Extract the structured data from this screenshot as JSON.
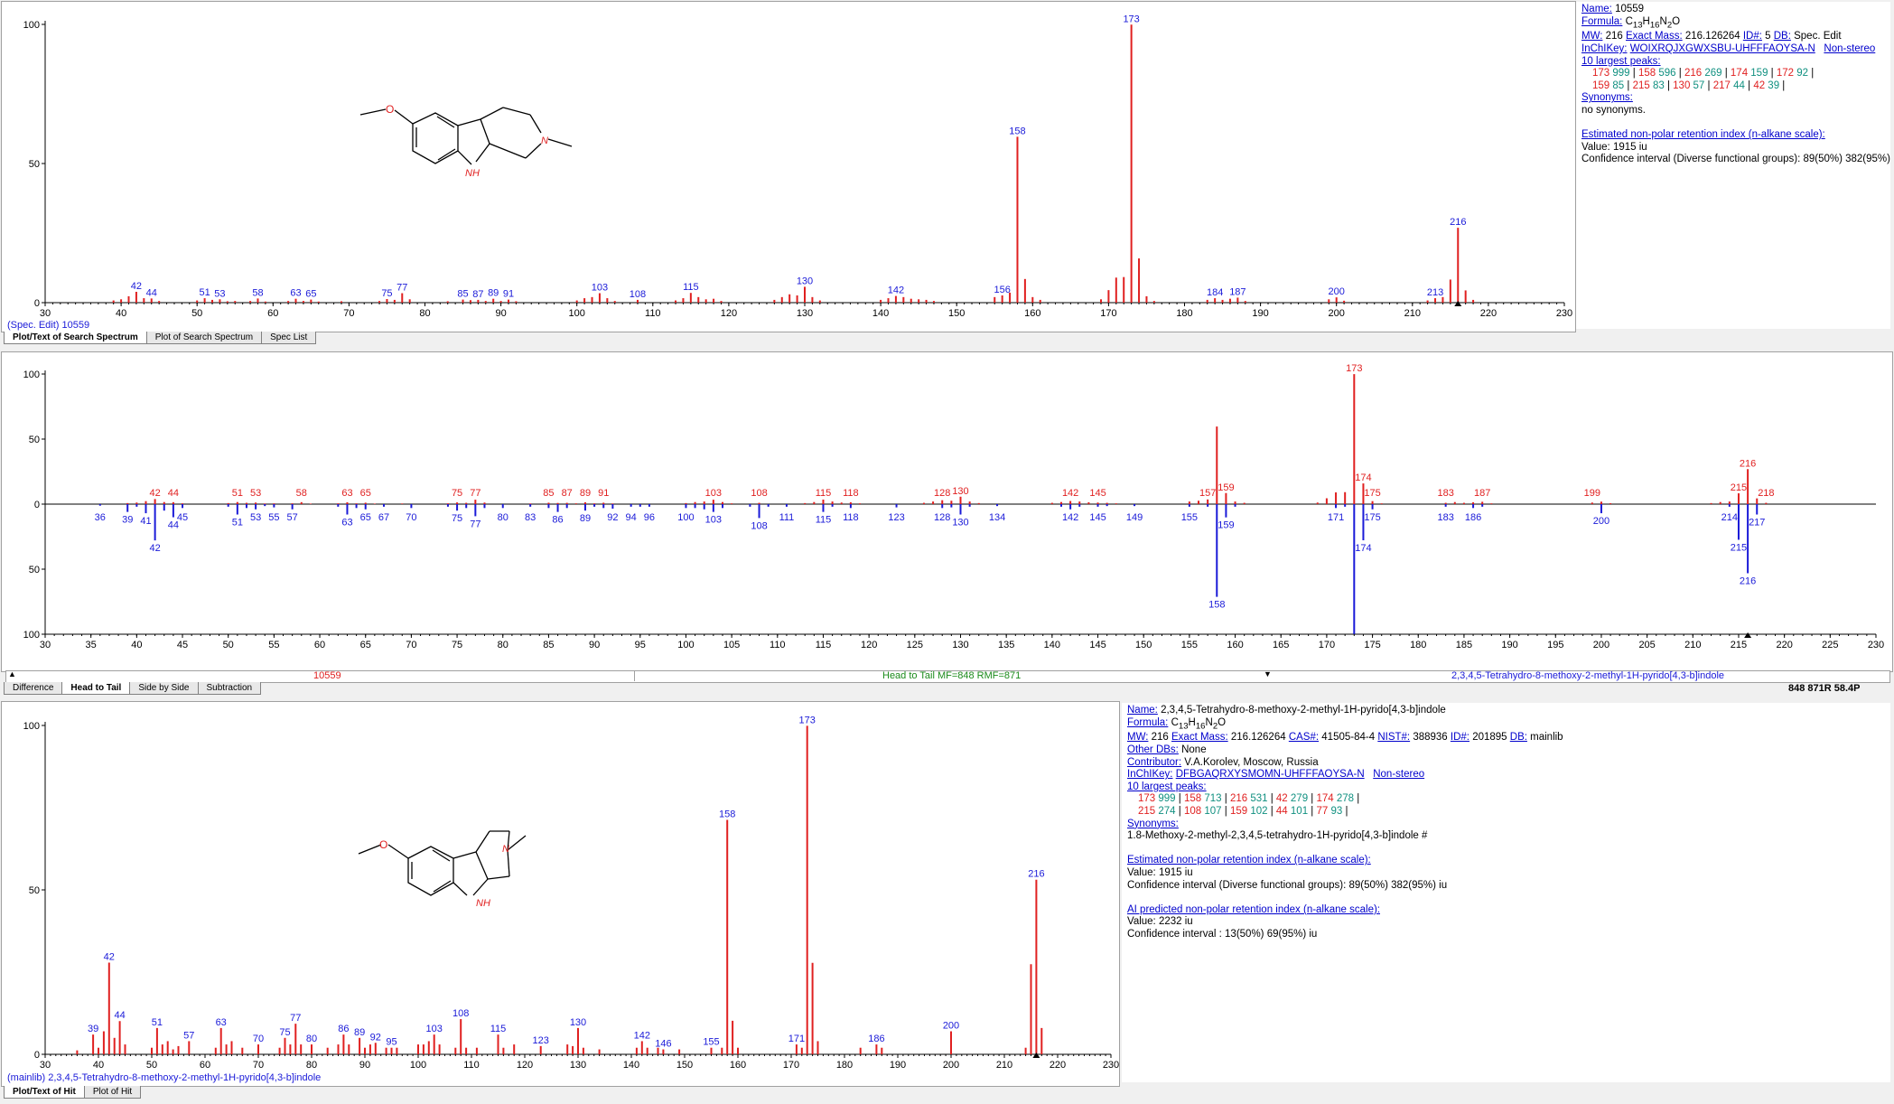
{
  "colors": {
    "match": "#e02020",
    "lib": "#1a1ad8",
    "unmatched": "#8080a0",
    "teal": "#109080",
    "status_green": "#1a8a1a"
  },
  "search": {
    "status": "(Spec. Edit) 10559",
    "tabs": [
      "Plot/Text of Search Spectrum",
      "Plot of Search Spectrum",
      "Spec List"
    ],
    "info": {
      "name_label": "Name:",
      "name": "10559",
      "formula_label": "Formula:",
      "formula": "C13H16N2O",
      "mw_label": "MW:",
      "mw": "216",
      "exact_label": "Exact Mass:",
      "exact": "216.126264",
      "id_label": "ID#:",
      "id": "5",
      "db_label": "DB:",
      "db": "Spec. Edit",
      "inchi_label": "InChIKey:",
      "inchi": "WOIXRQJXGWXSBU-UHFFFAOYSA-N",
      "nonstereo": "Non-stereo",
      "peaks_label": "10 largest peaks:",
      "peaks1": [
        [
          "173",
          "999"
        ],
        [
          "158",
          "596"
        ],
        [
          "216",
          "269"
        ],
        [
          "174",
          "159"
        ],
        [
          "172",
          "92"
        ]
      ],
      "peaks2": [
        [
          "159",
          "85"
        ],
        [
          "215",
          "83"
        ],
        [
          "130",
          "57"
        ],
        [
          "217",
          "44"
        ],
        [
          "42",
          "39"
        ]
      ],
      "syn_label": "Synonyms:",
      "syn": "no synonyms.",
      "ri_label": "Estimated non-polar retention index (n-alkane scale):",
      "ri_value": "Value: 1915 iu",
      "ri_ci": "Confidence interval (Diverse functional groups):  89(50%) 382(95%) iu"
    }
  },
  "compare": {
    "tabs": [
      "Difference",
      "Head to Tail",
      "Side by Side",
      "Subtraction"
    ],
    "left_label": "10559",
    "center_label": "Head to Tail MF=848 RMF=871",
    "right_label": "2,3,4,5-Tetrahydro-8-methoxy-2-methyl-1H-pyrido[4,3-b]indole",
    "score": "848 871R 58.4P"
  },
  "hit": {
    "status": "(mainlib) 2,3,4,5-Tetrahydro-8-methoxy-2-methyl-1H-pyrido[4,3-b]indole",
    "tabs": [
      "Plot/Text of Hit",
      "Plot of Hit"
    ],
    "info": {
      "name_label": "Name:",
      "name": "2,3,4,5-Tetrahydro-8-methoxy-2-methyl-1H-pyrido[4,3-b]indole",
      "formula_label": "Formula:",
      "formula": "C13H16N2O",
      "mw_label": "MW:",
      "mw": "216",
      "exact_label": "Exact Mass:",
      "exact": "216.126264",
      "cas_label": "CAS#:",
      "cas": "41505-84-4",
      "nist_label": "NIST#:",
      "nist": "388936",
      "id_label": "ID#:",
      "id": "201895",
      "db_label": "DB:",
      "db": "mainlib",
      "otherdb_label": "Other DBs:",
      "otherdb": "None",
      "contrib_label": "Contributor:",
      "contrib": "V.A.Korolev, Moscow, Russia",
      "inchi_label": "InChIKey:",
      "inchi": "DFBGAQRXYSMOMN-UHFFFAOYSA-N",
      "nonstereo": "Non-stereo",
      "peaks_label": "10 largest peaks:",
      "peaks1": [
        [
          "173",
          "999"
        ],
        [
          "158",
          "713"
        ],
        [
          "216",
          "531"
        ],
        [
          "42",
          "279"
        ],
        [
          "174",
          "278"
        ]
      ],
      "peaks2": [
        [
          "215",
          "274"
        ],
        [
          "108",
          "107"
        ],
        [
          "159",
          "102"
        ],
        [
          "44",
          "101"
        ],
        [
          "77",
          "93"
        ]
      ],
      "syn_label": "Synonyms:",
      "syn": "1.8-Methoxy-2-methyl-2,3,4,5-tetrahydro-1H-pyrido[4,3-b]indole  #",
      "ri_label": "Estimated non-polar retention index (n-alkane scale):",
      "ri_value": "Value: 1915 iu",
      "ri_ci": "Confidence interval (Diverse functional groups):  89(50%) 382(95%) iu",
      "ai_label": "AI predicted non-polar retention index (n-alkane scale):",
      "ai_value": "Value: 2232 iu",
      "ai_ci": "Confidence interval :  13(50%) 69(95%) iu"
    }
  },
  "structure_atoms": {
    "oxygen": "O",
    "nh": "NH",
    "n": "N"
  },
  "chart_data": [
    {
      "type": "bar",
      "name": "search-spectrum",
      "xlim": [
        30,
        230
      ],
      "ylim": [
        0,
        100
      ],
      "x_ticks": [
        30,
        40,
        50,
        60,
        70,
        80,
        90,
        100,
        110,
        120,
        130,
        140,
        150,
        160,
        170,
        180,
        190,
        200,
        210,
        220,
        230
      ],
      "y_ticks": [
        0,
        50,
        100
      ],
      "peaks": [
        [
          39,
          0.8
        ],
        [
          40,
          1.2
        ],
        [
          41,
          2.3
        ],
        [
          42,
          3.9
        ],
        [
          43,
          1.6
        ],
        [
          44,
          1.5
        ],
        [
          45,
          0.6
        ],
        [
          50,
          0.8
        ],
        [
          51,
          1.6
        ],
        [
          52,
          1.0
        ],
        [
          53,
          1.2
        ],
        [
          54,
          0.5
        ],
        [
          55,
          0.6
        ],
        [
          57,
          0.6
        ],
        [
          58,
          1.5
        ],
        [
          59,
          0.4
        ],
        [
          62,
          0.6
        ],
        [
          63,
          1.4
        ],
        [
          64,
          0.6
        ],
        [
          65,
          1.1
        ],
        [
          66,
          0.4
        ],
        [
          69,
          0.5
        ],
        [
          74,
          0.6
        ],
        [
          75,
          1.3
        ],
        [
          76,
          1.0
        ],
        [
          77,
          3.4
        ],
        [
          78,
          1.2
        ],
        [
          83,
          0.5
        ],
        [
          85,
          1.1
        ],
        [
          86,
          0.9
        ],
        [
          87,
          1.0
        ],
        [
          88,
          0.6
        ],
        [
          89,
          1.4
        ],
        [
          90,
          0.6
        ],
        [
          91,
          1.1
        ],
        [
          92,
          0.5
        ],
        [
          100,
          0.8
        ],
        [
          101,
          1.6
        ],
        [
          102,
          2.0
        ],
        [
          103,
          3.4
        ],
        [
          104,
          1.6
        ],
        [
          105,
          0.6
        ],
        [
          108,
          1.0
        ],
        [
          113,
          0.8
        ],
        [
          114,
          1.6
        ],
        [
          115,
          3.5
        ],
        [
          116,
          2.0
        ],
        [
          117,
          1.2
        ],
        [
          118,
          1.4
        ],
        [
          119,
          0.6
        ],
        [
          126,
          1.0
        ],
        [
          127,
          2.0
        ],
        [
          128,
          3.0
        ],
        [
          129,
          2.6
        ],
        [
          130,
          5.7
        ],
        [
          131,
          2.0
        ],
        [
          132,
          0.8
        ],
        [
          140,
          1.0
        ],
        [
          141,
          1.6
        ],
        [
          142,
          2.4
        ],
        [
          143,
          2.0
        ],
        [
          144,
          1.4
        ],
        [
          145,
          1.2
        ],
        [
          146,
          1.0
        ],
        [
          147,
          0.6
        ],
        [
          155,
          2.0
        ],
        [
          156,
          2.6
        ],
        [
          157,
          3.6
        ],
        [
          158,
          59.6
        ],
        [
          159,
          8.5
        ],
        [
          160,
          2.0
        ],
        [
          161,
          1.0
        ],
        [
          169,
          1.2
        ],
        [
          170,
          4.5
        ],
        [
          171,
          9.0
        ],
        [
          172,
          9.2
        ],
        [
          173,
          99.9
        ],
        [
          174,
          15.9
        ],
        [
          175,
          2.3
        ],
        [
          176,
          0.6
        ],
        [
          183,
          1.0
        ],
        [
          184,
          1.6
        ],
        [
          185,
          1.0
        ],
        [
          186,
          1.4
        ],
        [
          187,
          1.8
        ],
        [
          188,
          0.6
        ],
        [
          199,
          1.2
        ],
        [
          200,
          1.9
        ],
        [
          201,
          0.7
        ],
        [
          212,
          0.8
        ],
        [
          213,
          1.6
        ],
        [
          214,
          2.0
        ],
        [
          215,
          8.3
        ],
        [
          216,
          26.9
        ],
        [
          217,
          4.4
        ],
        [
          218,
          1.0
        ]
      ],
      "labels": [
        42,
        44,
        51,
        53,
        58,
        63,
        65,
        75,
        77,
        85,
        87,
        89,
        91,
        103,
        108,
        115,
        130,
        142,
        156,
        158,
        173,
        184,
        187,
        200,
        213,
        216
      ]
    },
    {
      "type": "bar",
      "name": "head-to-tail",
      "xlim": [
        30,
        230
      ],
      "ylim": [
        -100,
        100
      ],
      "x_ticks": [
        30,
        35,
        40,
        45,
        50,
        55,
        60,
        65,
        70,
        75,
        80,
        85,
        90,
        95,
        100,
        105,
        110,
        115,
        120,
        125,
        130,
        135,
        140,
        145,
        150,
        155,
        160,
        165,
        170,
        175,
        180,
        185,
        190,
        195,
        200,
        205,
        210,
        215,
        220,
        225,
        230
      ],
      "y_ticks": [
        -100,
        -50,
        0,
        50,
        100
      ],
      "upper_labels": [
        42,
        44,
        51,
        53,
        58,
        63,
        65,
        75,
        77,
        85,
        87,
        89,
        91,
        103,
        108,
        115,
        118,
        128,
        130,
        142,
        145,
        157,
        159,
        173,
        174,
        175,
        183,
        187,
        199,
        215,
        216,
        218
      ],
      "lower_labels": [
        36,
        39,
        41,
        42,
        44,
        45,
        51,
        53,
        55,
        57,
        63,
        65,
        67,
        70,
        75,
        77,
        80,
        83,
        86,
        89,
        92,
        94,
        96,
        100,
        103,
        108,
        111,
        115,
        118,
        123,
        128,
        130,
        134,
        142,
        145,
        149,
        155,
        158,
        159,
        171,
        174,
        175,
        183,
        186,
        200,
        214,
        215,
        216,
        217
      ],
      "lower_peaks": [
        [
          36,
          1.2
        ],
        [
          39,
          6.0
        ],
        [
          40,
          2.0
        ],
        [
          41,
          7.0
        ],
        [
          42,
          27.9
        ],
        [
          43,
          5.0
        ],
        [
          44,
          10.1
        ],
        [
          45,
          3.0
        ],
        [
          50,
          2.0
        ],
        [
          51,
          8.0
        ],
        [
          52,
          3.0
        ],
        [
          53,
          4.0
        ],
        [
          54,
          1.5
        ],
        [
          55,
          2.5
        ],
        [
          57,
          4.0
        ],
        [
          62,
          2.0
        ],
        [
          63,
          8.0
        ],
        [
          64,
          3.0
        ],
        [
          65,
          4.0
        ],
        [
          67,
          2.0
        ],
        [
          70,
          3.0
        ],
        [
          74,
          2.0
        ],
        [
          75,
          5.0
        ],
        [
          76,
          3.0
        ],
        [
          77,
          9.3
        ],
        [
          78,
          3.0
        ],
        [
          80,
          3.0
        ],
        [
          83,
          2.0
        ],
        [
          85,
          3.0
        ],
        [
          86,
          6.0
        ],
        [
          87,
          3.0
        ],
        [
          89,
          5.0
        ],
        [
          90,
          2.0
        ],
        [
          91,
          3.0
        ],
        [
          92,
          3.5
        ],
        [
          94,
          2.0
        ],
        [
          95,
          2.0
        ],
        [
          96,
          2.0
        ],
        [
          100,
          3.0
        ],
        [
          101,
          3.0
        ],
        [
          102,
          4.0
        ],
        [
          103,
          6.0
        ],
        [
          104,
          3.0
        ],
        [
          107,
          2.0
        ],
        [
          108,
          10.7
        ],
        [
          109,
          2.0
        ],
        [
          111,
          2.0
        ],
        [
          115,
          6.0
        ],
        [
          116,
          2.0
        ],
        [
          118,
          3.0
        ],
        [
          123,
          2.5
        ],
        [
          128,
          3.0
        ],
        [
          129,
          2.5
        ],
        [
          130,
          8.0
        ],
        [
          131,
          2.0
        ],
        [
          134,
          1.5
        ],
        [
          141,
          2.0
        ],
        [
          142,
          4.0
        ],
        [
          143,
          2.0
        ],
        [
          145,
          2.0
        ],
        [
          146,
          1.5
        ],
        [
          149,
          1.5
        ],
        [
          155,
          2.0
        ],
        [
          157,
          2.0
        ],
        [
          158,
          71.3
        ],
        [
          159,
          10.2
        ],
        [
          160,
          2.0
        ],
        [
          171,
          3.0
        ],
        [
          172,
          2.0
        ],
        [
          173,
          99.9
        ],
        [
          174,
          27.8
        ],
        [
          175,
          4.0
        ],
        [
          183,
          2.0
        ],
        [
          186,
          3.0
        ],
        [
          187,
          2.0
        ],
        [
          200,
          7.0
        ],
        [
          214,
          2.0
        ],
        [
          215,
          27.4
        ],
        [
          216,
          53.1
        ],
        [
          217,
          8.0
        ]
      ]
    },
    {
      "type": "bar",
      "name": "hit-spectrum",
      "xlim": [
        30,
        230
      ],
      "ylim": [
        0,
        100
      ],
      "x_ticks": [
        30,
        40,
        50,
        60,
        70,
        80,
        90,
        100,
        110,
        120,
        130,
        140,
        150,
        160,
        170,
        180,
        190,
        200,
        210,
        220,
        230
      ],
      "y_ticks": [
        0,
        50,
        100
      ],
      "labels": [
        39,
        42,
        44,
        51,
        57,
        63,
        70,
        75,
        77,
        80,
        86,
        89,
        92,
        95,
        103,
        108,
        115,
        123,
        130,
        142,
        146,
        155,
        158,
        171,
        173,
        186,
        200,
        216
      ]
    }
  ]
}
